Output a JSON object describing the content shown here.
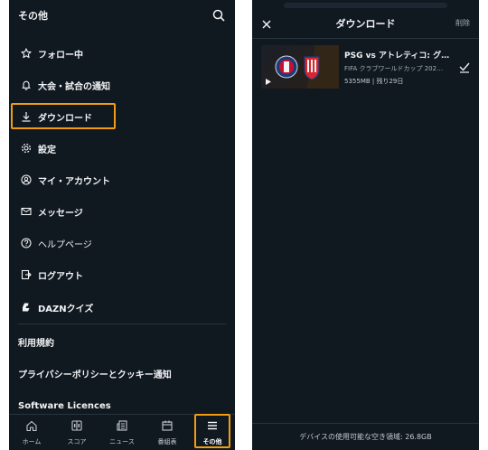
{
  "left": {
    "header": {
      "title": "その他",
      "search_icon": "search-icon"
    },
    "menu": [
      {
        "label": "フォロー中",
        "icon": "star-icon"
      },
      {
        "label": "大会・試合の通知",
        "icon": "bell-icon"
      },
      {
        "label": "ダウンロード",
        "icon": "download-icon"
      },
      {
        "label": "設定",
        "icon": "gear-icon"
      },
      {
        "label": "マイ・アカウント",
        "icon": "user-icon"
      },
      {
        "label": "メッセージ",
        "icon": "mail-icon"
      },
      {
        "label": "ヘルプページ",
        "icon": "help-icon"
      },
      {
        "label": "ログアウト",
        "icon": "logout-icon"
      },
      {
        "label": "DAZNクイズ",
        "icon": "quiz-icon"
      }
    ],
    "links": [
      {
        "label": "利用規約"
      },
      {
        "label": "プライバシーポリシーとクッキー通知"
      },
      {
        "label": "Software Licences"
      }
    ],
    "tabs": [
      {
        "label": "ホーム",
        "icon": "home-icon"
      },
      {
        "label": "スコア",
        "icon": "scores-icon"
      },
      {
        "label": "ニュース",
        "icon": "news-icon"
      },
      {
        "label": "番組表",
        "icon": "calendar-icon"
      },
      {
        "label": "その他",
        "icon": "menu-icon"
      }
    ],
    "highlight_color": "#f39c12"
  },
  "right": {
    "header": {
      "title": "ダウンロード",
      "delete_label": "削除",
      "close_icon": "close-icon"
    },
    "item": {
      "title": "PSG vs アトレティコ: グ…",
      "subtitle": "FIFA クラブワールドカップ 202…",
      "meta": "5355MB | 残り29日",
      "team_logos": [
        "psg-logo",
        "atletico-logo"
      ],
      "check_icon": "check-icon"
    },
    "storage": "デバイスの使用可能な空き領域: 26.8GB"
  },
  "colors": {
    "background": "#101820",
    "accent": "#f39c12",
    "text": "#f1f3f4"
  }
}
